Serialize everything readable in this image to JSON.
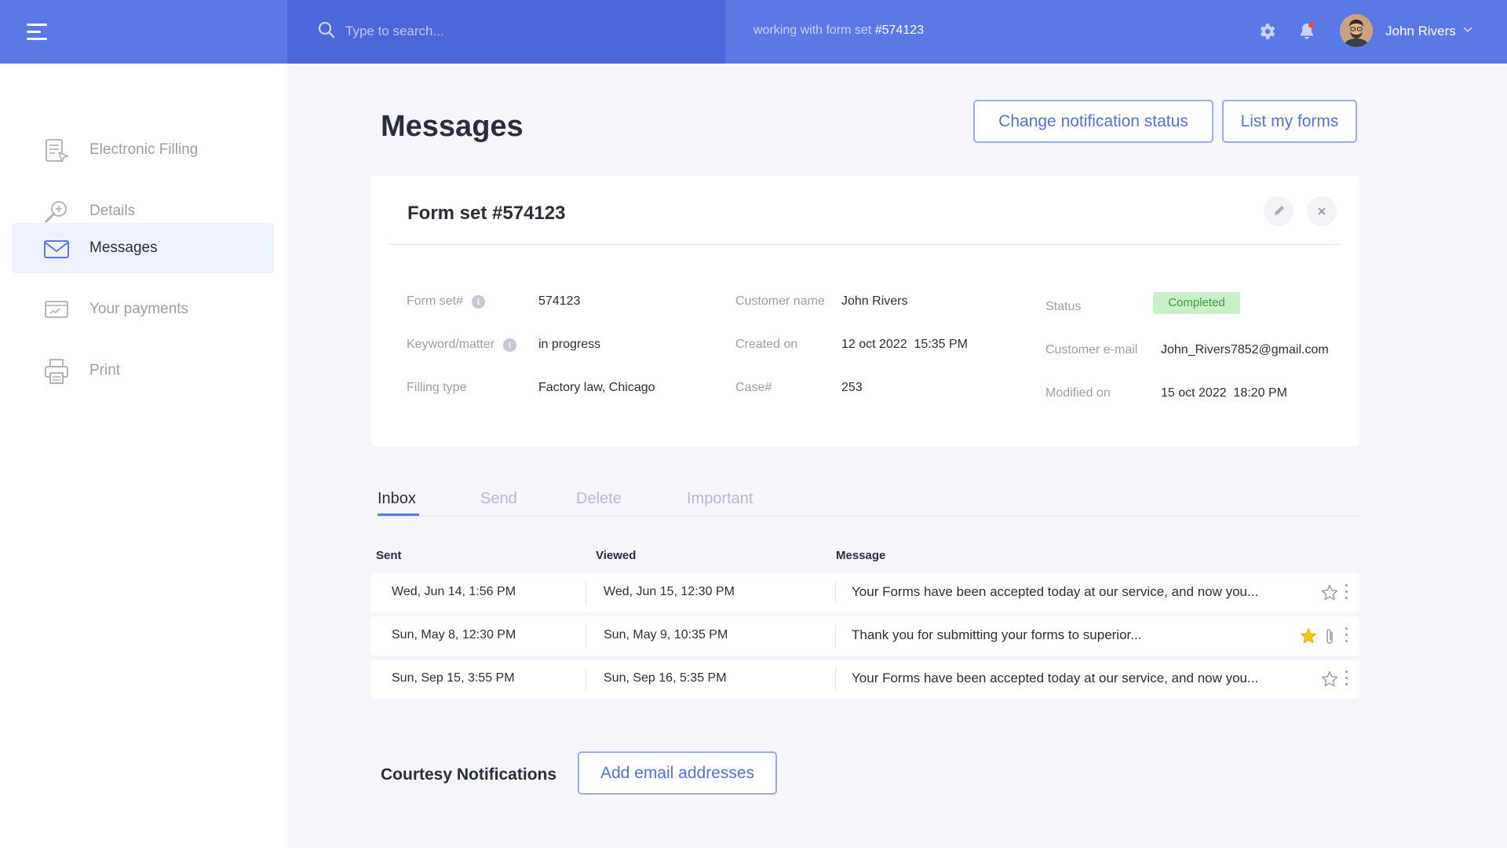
{
  "topbar": {
    "search_placeholder": "Type to search...",
    "context_prefix": "working with form set",
    "context_id": "#574123",
    "user_name": "John Rivers"
  },
  "sidebar": {
    "items": [
      {
        "label": "Electronic Filling",
        "icon": "document-pointer-icon",
        "active": false
      },
      {
        "label": "Details",
        "icon": "magnifier-plus-icon",
        "active": false
      },
      {
        "label": "Messages",
        "icon": "envelope-icon",
        "active": true
      },
      {
        "label": "Your payments",
        "icon": "payment-card-icon",
        "active": false
      },
      {
        "label": "Print",
        "icon": "printer-icon",
        "active": false
      }
    ]
  },
  "main": {
    "title": "Messages",
    "change_notification_label": "Change notification status",
    "list_forms_label": "List my forms"
  },
  "form_card": {
    "title": "Form set #574123",
    "fields": {
      "form_set": {
        "label": "Form set#",
        "value": "574123"
      },
      "keyword": {
        "label": "Keyword/matter",
        "value": "in progress"
      },
      "filling_type": {
        "label": "Filling type",
        "value": "Factory law, Chicago"
      },
      "customer_name": {
        "label": "Customer name",
        "value": "John Rivers"
      },
      "created_on": {
        "label": "Created on",
        "value": "12 oct 2022  15:35 PM"
      },
      "case": {
        "label": "Case#",
        "value": "253"
      },
      "status": {
        "label": "Status",
        "value": "Completed"
      },
      "customer_email": {
        "label": "Customer e-mail",
        "value": "John_Rivers7852@gmail.com"
      },
      "modified_on": {
        "label": "Modified on",
        "value": "15 oct 2022  18:20 PM"
      }
    }
  },
  "tabs": [
    "Inbox",
    "Send",
    "Delete",
    "Important"
  ],
  "table": {
    "headers": [
      "Sent",
      "Viewed",
      "Message"
    ],
    "rows": [
      {
        "sent": "Wed, Jun 14, 1:56 PM",
        "viewed": "Wed, Jun 15, 12:30 PM",
        "message": "Your Forms have been accepted today at our service, and now you...",
        "starred": false,
        "attachment": false
      },
      {
        "sent": "Sun, May 8, 12:30 PM",
        "viewed": "Sun, May 9, 10:35 PM",
        "message": "Thank you for submitting your forms to superior...",
        "starred": true,
        "attachment": true
      },
      {
        "sent": "Sun, Sep 15, 3:55 PM",
        "viewed": "Sun, Sep 16, 5:35 PM",
        "message": "Your Forms have been accepted today at our service, and now you...",
        "starred": false,
        "attachment": false
      }
    ]
  },
  "courtesy": {
    "title": "Courtesy Notifications",
    "add_label": "Add email addresses"
  },
  "colors": {
    "brand": "#5a78e6",
    "search_bg": "#4c68d8",
    "status_bg": "#c9efc6",
    "status_text": "#3a9c43",
    "star": "#f5c518",
    "notification_dot": "#f04a4a"
  }
}
